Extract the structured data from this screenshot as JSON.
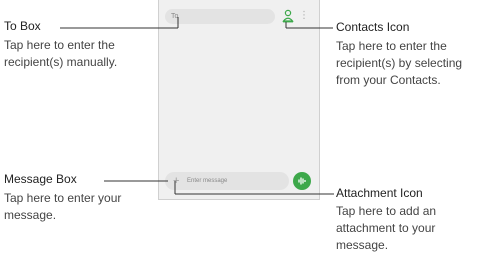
{
  "phone": {
    "to_placeholder": "To",
    "message_placeholder": "Enter message"
  },
  "callouts": {
    "to_box": {
      "title": "To Box",
      "desc": "Tap here to enter the recipient(s) manually."
    },
    "contacts_icon": {
      "title": "Contacts Icon",
      "desc": "Tap here to enter the recipient(s) by selecting from your Contacts."
    },
    "message_box": {
      "title": "Message Box",
      "desc": "Tap here to enter your message."
    },
    "attachment_icon": {
      "title": "Attachment Icon",
      "desc": "Tap here to add an attachment to your message."
    }
  },
  "colors": {
    "send_button": "#3da84a",
    "contacts_icon": "#3da84a",
    "leader_line": "#333333"
  }
}
